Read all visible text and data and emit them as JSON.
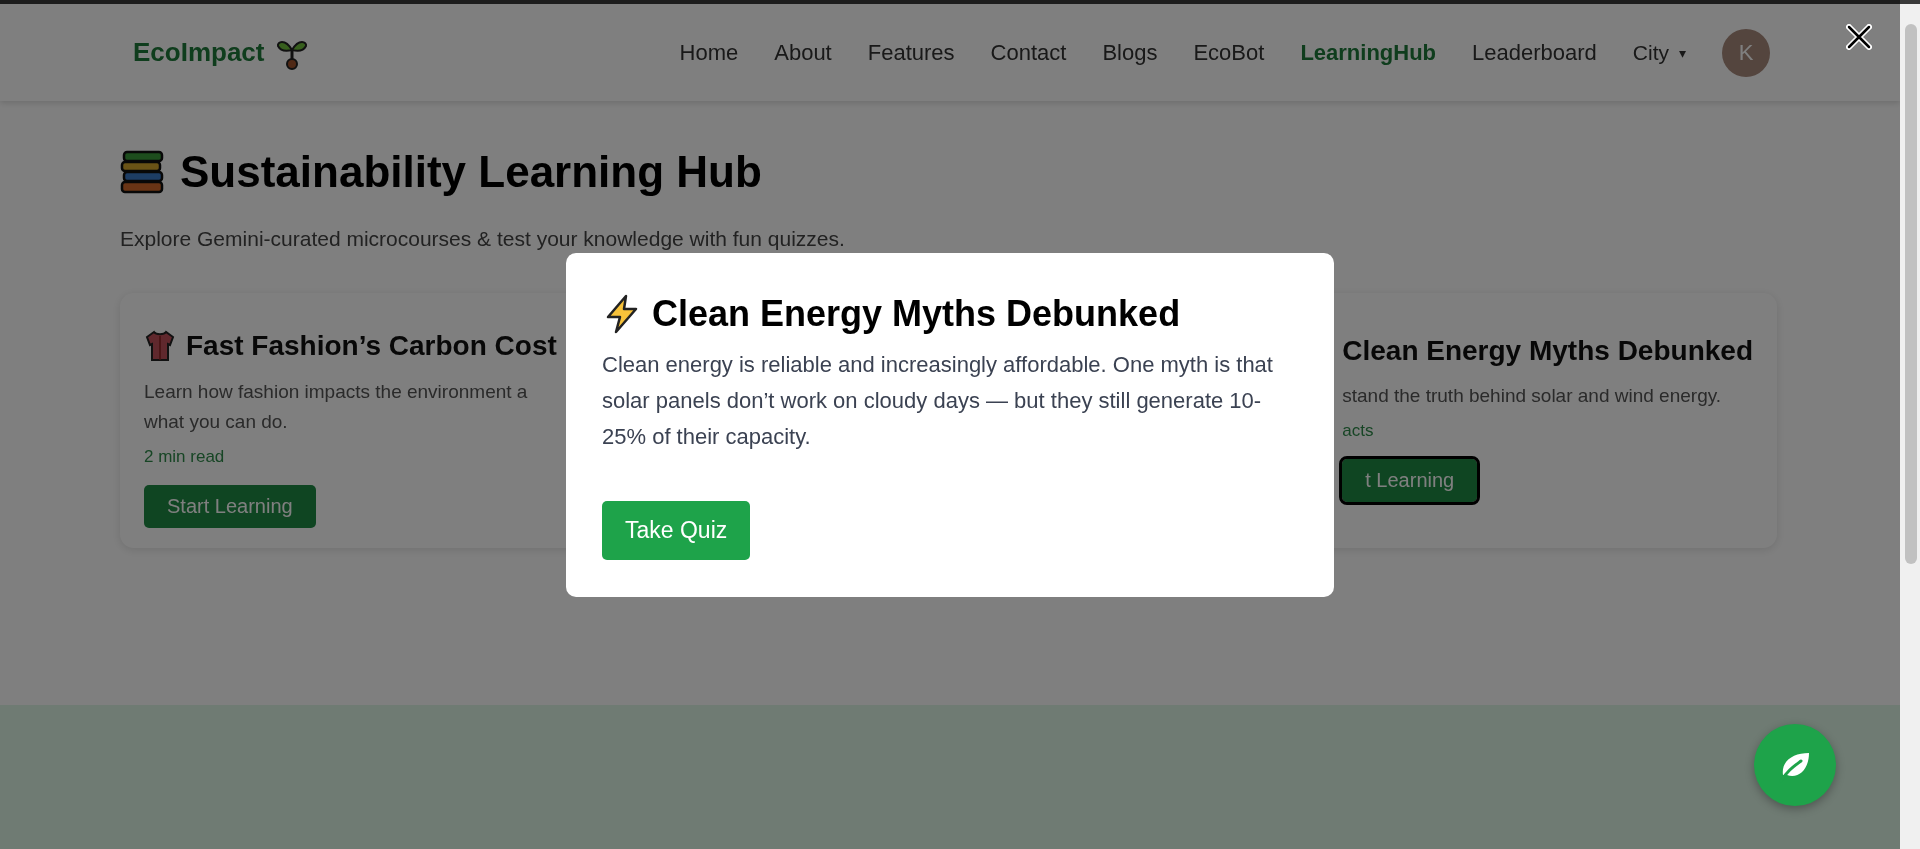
{
  "header": {
    "logo": "EcoImpact",
    "nav": [
      {
        "label": "Home",
        "selected": false
      },
      {
        "label": "About",
        "selected": false
      },
      {
        "label": "Features",
        "selected": false
      },
      {
        "label": "Contact",
        "selected": false
      },
      {
        "label": "Blogs",
        "selected": false
      },
      {
        "label": "EcoBot",
        "selected": false
      },
      {
        "label": "LearningHub",
        "selected": true
      },
      {
        "label": "Leaderboard",
        "selected": false
      }
    ],
    "city_menu": {
      "label": "City",
      "caret": "▾"
    },
    "avatar": "K"
  },
  "hub": {
    "title": "Sustainability Learning Hub",
    "subtitle": "Explore Gemini-curated microcourses & test your knowledge with fun quizzes."
  },
  "cards": [
    {
      "kind": "full",
      "title": "Fast Fashion’s Carbon Cost",
      "description": "Learn how fashion impacts the environment a\nwhat you can do.",
      "meta": "2 min read",
      "button": "Start Learning",
      "focused": false
    },
    {
      "kind": "covered",
      "title": "Clean Energy Myths Debunked",
      "description": "stand the truth behind solar and wind energy.",
      "meta": "acts",
      "button": "t Learning",
      "focused": true
    }
  ],
  "modal": {
    "title": "Clean Energy Myths Debunked",
    "body": "Clean energy is reliable and increasingly affordable. One myth is that solar panels don’t work on cloudy days — but they still generate 10-25% of their capacity.",
    "button": "Take Quiz"
  }
}
